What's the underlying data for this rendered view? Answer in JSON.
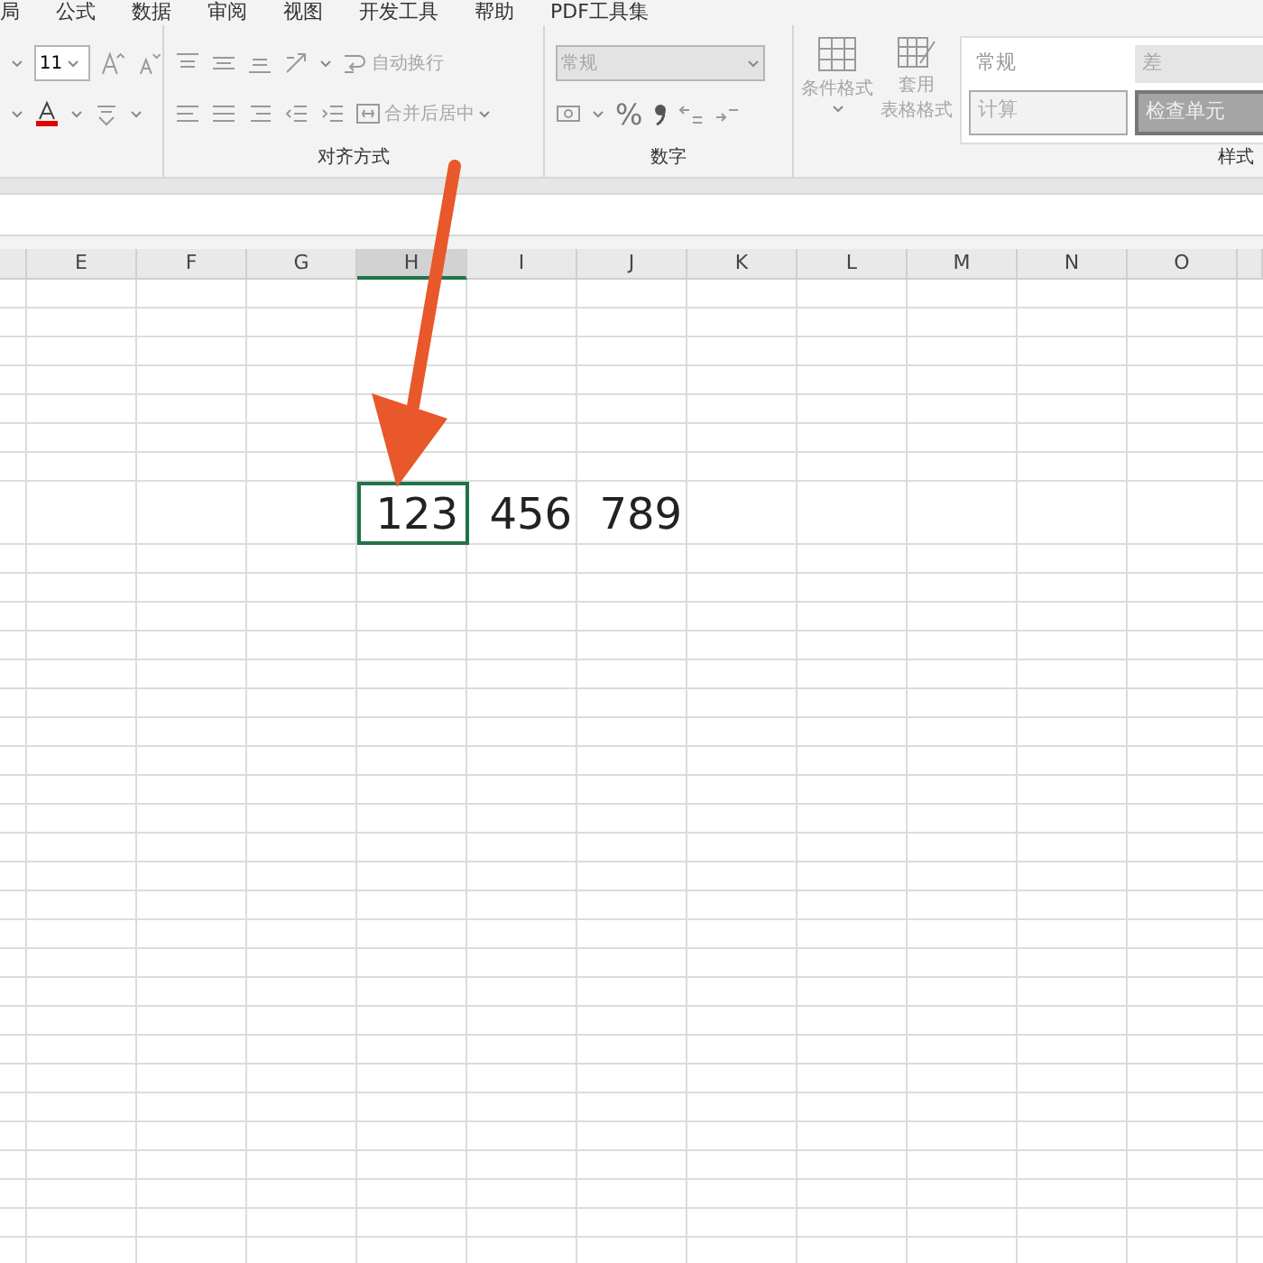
{
  "menu_tabs": [
    {
      "label": "局",
      "selected": false
    },
    {
      "label": "公式",
      "selected": false
    },
    {
      "label": "数据",
      "selected": false
    },
    {
      "label": "审阅",
      "selected": false
    },
    {
      "label": "视图",
      "selected": false
    },
    {
      "label": "开发工具",
      "selected": false
    },
    {
      "label": "帮助",
      "selected": false
    },
    {
      "label": "PDF工具集",
      "selected": false
    }
  ],
  "ribbon": {
    "font": {
      "size": "11"
    },
    "alignment": {
      "wrap_text": "自动换行",
      "merge_center": "合并后居中",
      "label": "对齐方式"
    },
    "number": {
      "format": "常规",
      "percent": "%",
      "label": "数字"
    },
    "styles": {
      "conditional": "条件格式",
      "table_format": [
        "套用",
        "表格格式"
      ],
      "gallery": [
        {
          "label": "常规",
          "kind": "normal"
        },
        {
          "label": "差",
          "kind": "bad"
        },
        {
          "label": "计算",
          "kind": "calc"
        },
        {
          "label": "检查单元",
          "kind": "check"
        }
      ],
      "label": "样式"
    }
  },
  "columns": [
    {
      "label": "E",
      "selected": false
    },
    {
      "label": "F",
      "selected": false
    },
    {
      "label": "G",
      "selected": false
    },
    {
      "label": "H",
      "selected": true,
      "value": "123"
    },
    {
      "label": "I",
      "selected": false,
      "value": "456"
    },
    {
      "label": "J",
      "selected": false,
      "value": "789"
    },
    {
      "label": "K",
      "selected": false
    },
    {
      "label": "L",
      "selected": false
    },
    {
      "label": "M",
      "selected": false
    },
    {
      "label": "N",
      "selected": false
    },
    {
      "label": "O",
      "selected": false
    }
  ]
}
